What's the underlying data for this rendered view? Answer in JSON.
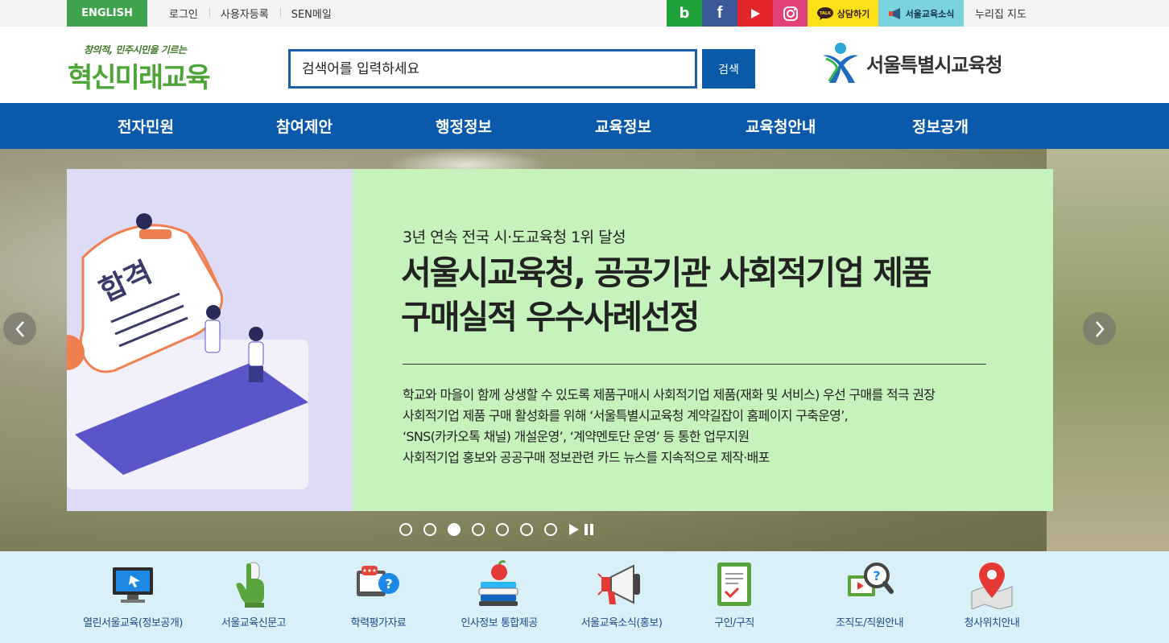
{
  "topbar": {
    "english": "ENGLISH",
    "links": [
      "로그인",
      "사용자등록",
      "SEN메일"
    ],
    "sns": {
      "blog": "b",
      "facebook": "f"
    },
    "talk_label": "상담하기",
    "talk_badge": "TALK",
    "news_label": "서울교육소식",
    "sitemap": "누리집 지도"
  },
  "header": {
    "slogan_small": "창의적, 민주시민을 기르는",
    "slogan_big": "혁신미래교육",
    "search_placeholder": "검색어를 입력하세요",
    "search_button": "검색",
    "org_name": "서울특별시교육청"
  },
  "gnb": [
    "전자민원",
    "참여제안",
    "행정정보",
    "교육정보",
    "교육청안내",
    "정보공개"
  ],
  "hero": {
    "illustration_text": "합격",
    "kicker": "3년 연속 전국 시·도교육청 1위 달성",
    "title_line1": "서울시교육청, 공공기관 사회적기업 제품",
    "title_line2": "구매실적 우수사례선정",
    "body": [
      "학교와 마을이 함께 상생할 수 있도록 제품구매시 사회적기업 제품(재화 및 서비스) 우선 구매를 적극 권장",
      "사회적기업 제품 구매 활성화를 위해 ‘서울특별시교육청 계약길잡이 홈페이지 구축운영’,",
      "‘SNS(카카오톡 채널) 개설운영’, ‘계약멘토단 운영’ 등 통한 업무지원",
      "사회적기업 홍보와 공공구매 정보관련 카드 뉴스를 지속적으로 제작·배포"
    ],
    "slide_count": 7,
    "active_slide": 3
  },
  "quick_menu": [
    {
      "label": "열린서울교육(정보공개)",
      "icon": "monitor-icon"
    },
    {
      "label": "서울교육신문고",
      "icon": "hand-cursor-icon"
    },
    {
      "label": "학력평가자료",
      "icon": "chat-question-icon"
    },
    {
      "label": "인사정보 통합제공",
      "icon": "books-apple-icon"
    },
    {
      "label": "서울교육소식(홍보)",
      "icon": "megaphone-icon"
    },
    {
      "label": "구인/구직",
      "icon": "clipboard-check-icon"
    },
    {
      "label": "조직도/직원안내",
      "icon": "magnifier-question-icon"
    },
    {
      "label": "청사위치안내",
      "icon": "map-pin-icon"
    }
  ],
  "colors": {
    "english_green": "#3ea34a",
    "nav_blue": "#0b59ab",
    "banner_green": "#c6f2bb",
    "banner_lavender": "#dedbf7",
    "quick_bg": "#daf0f9"
  }
}
